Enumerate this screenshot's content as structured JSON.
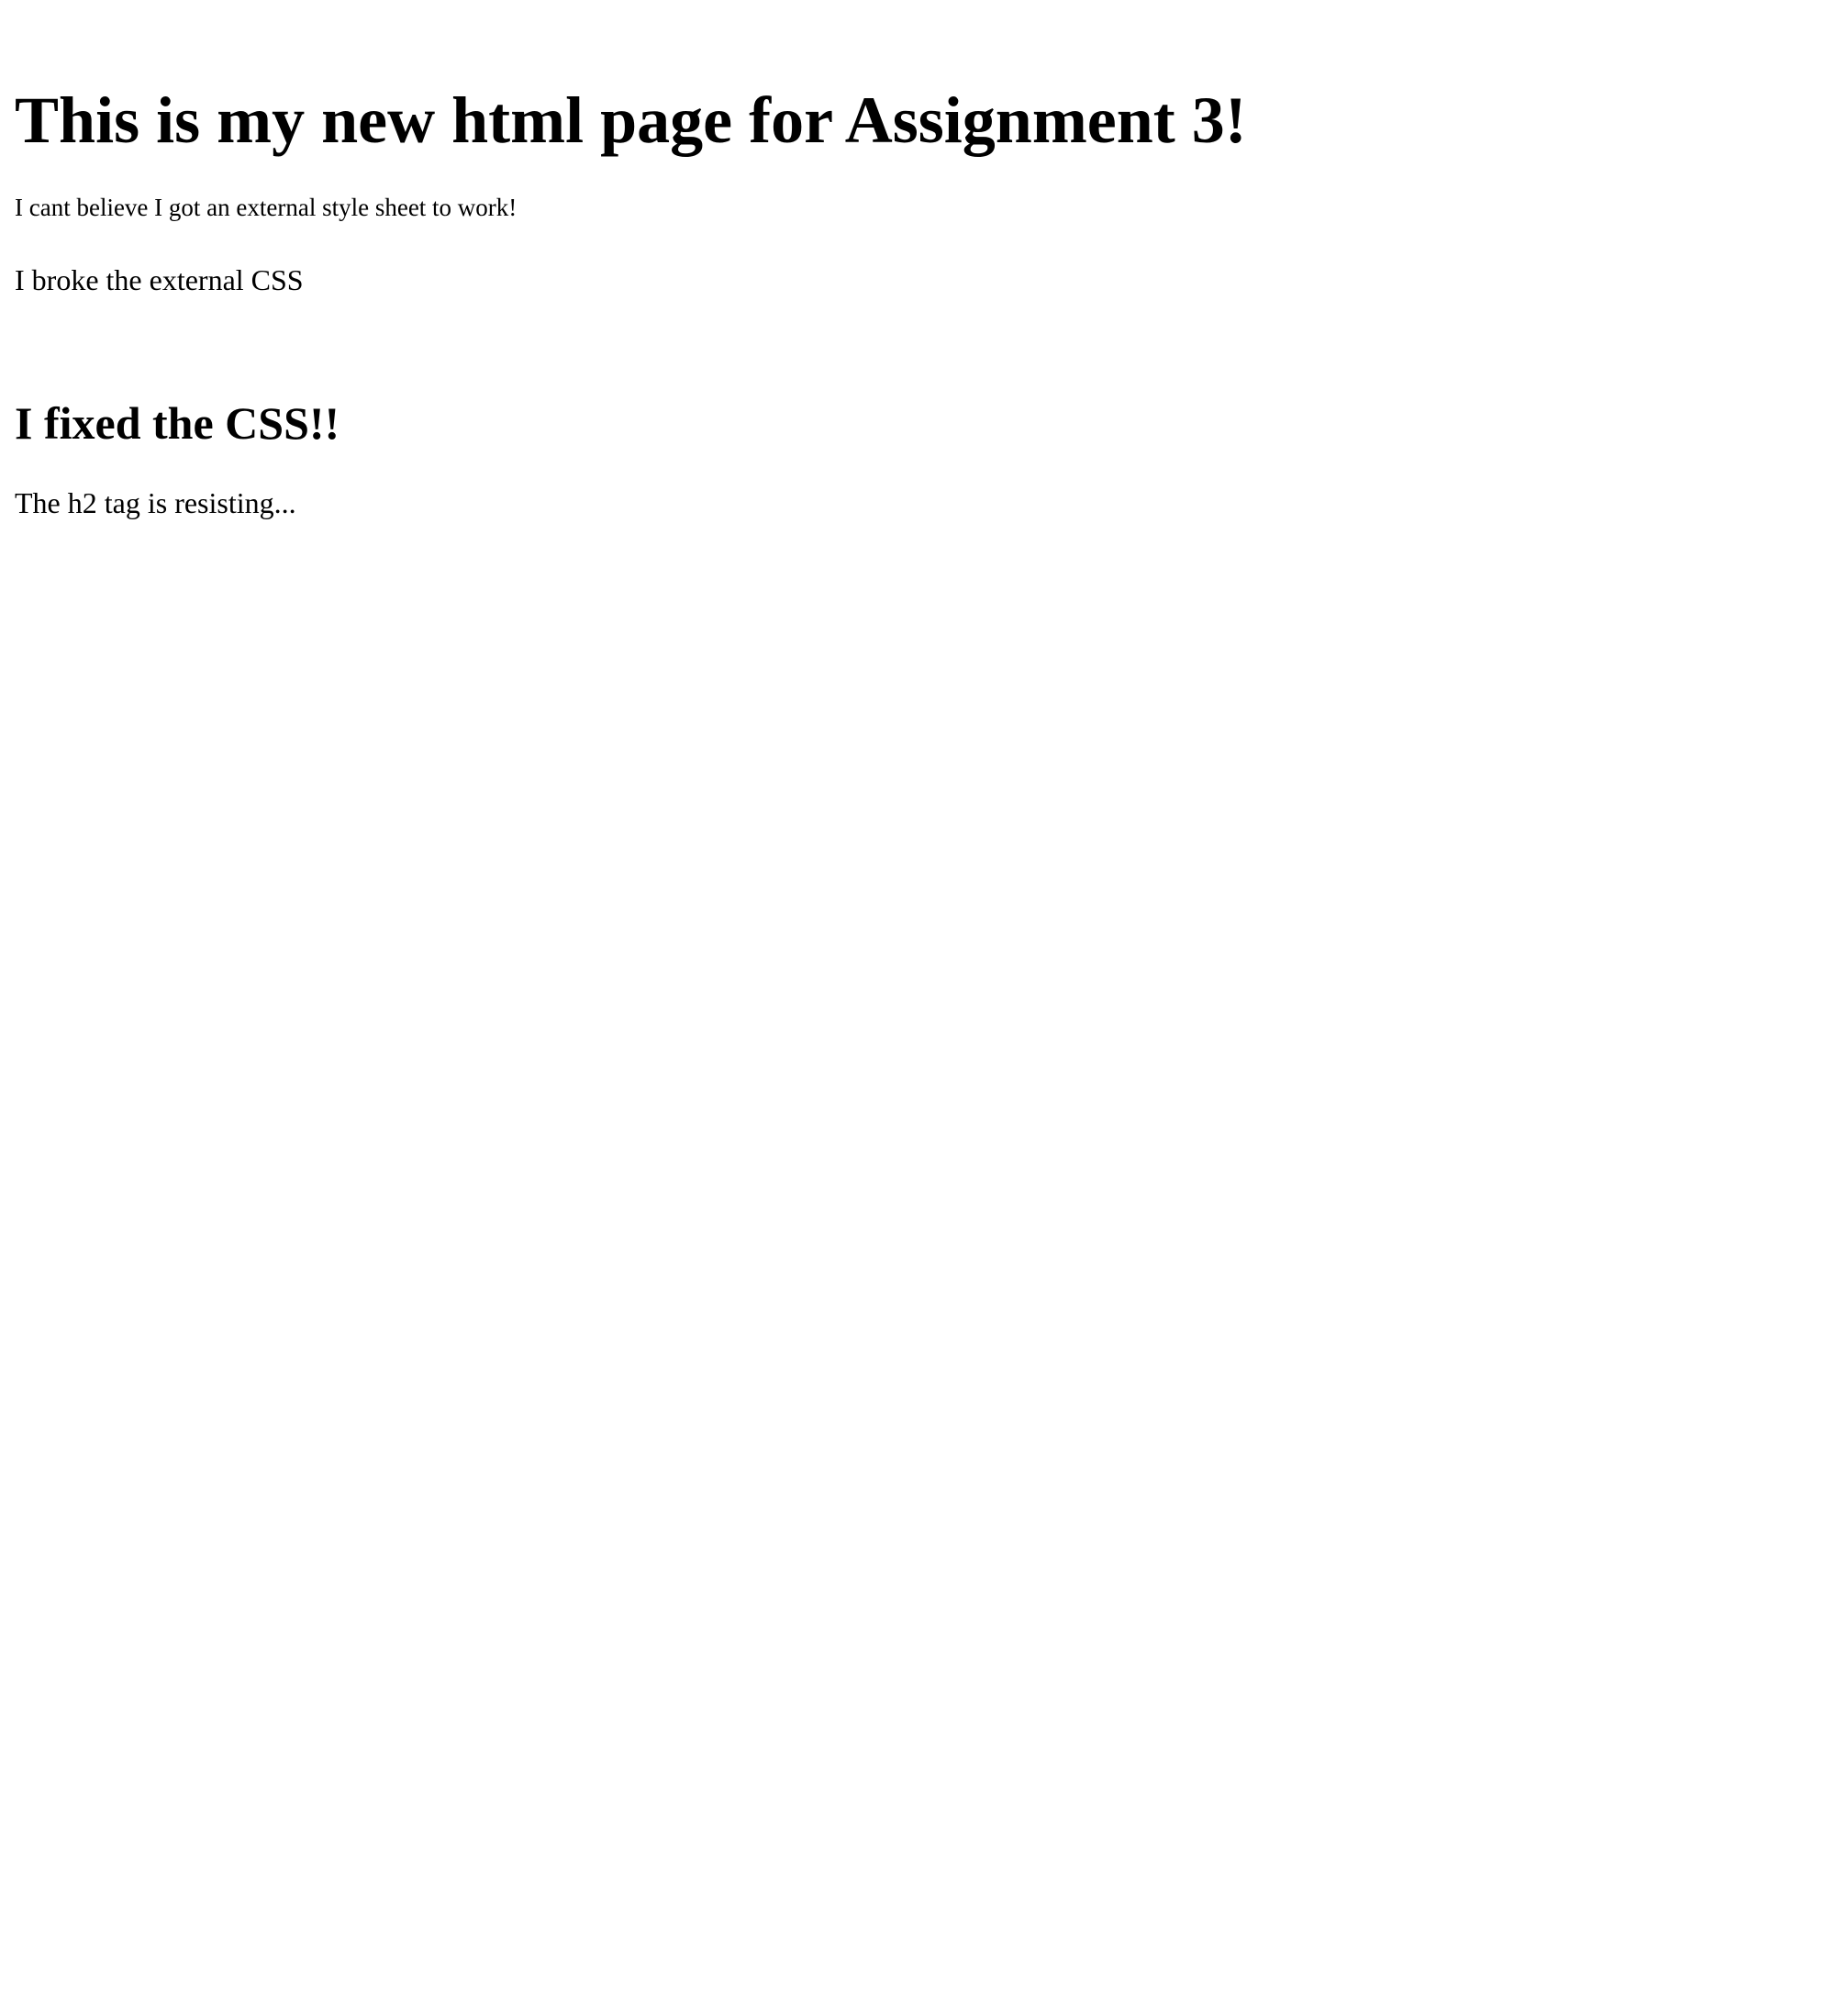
{
  "main": {
    "heading": "This is my new html page for Assignment 3!",
    "intro_text": "I cant believe I got an external style sheet to work!",
    "broke_text": "I broke the external CSS",
    "fixed_heading": "I fixed the CSS!!",
    "h2_text": "The h2 tag is resisting..."
  }
}
